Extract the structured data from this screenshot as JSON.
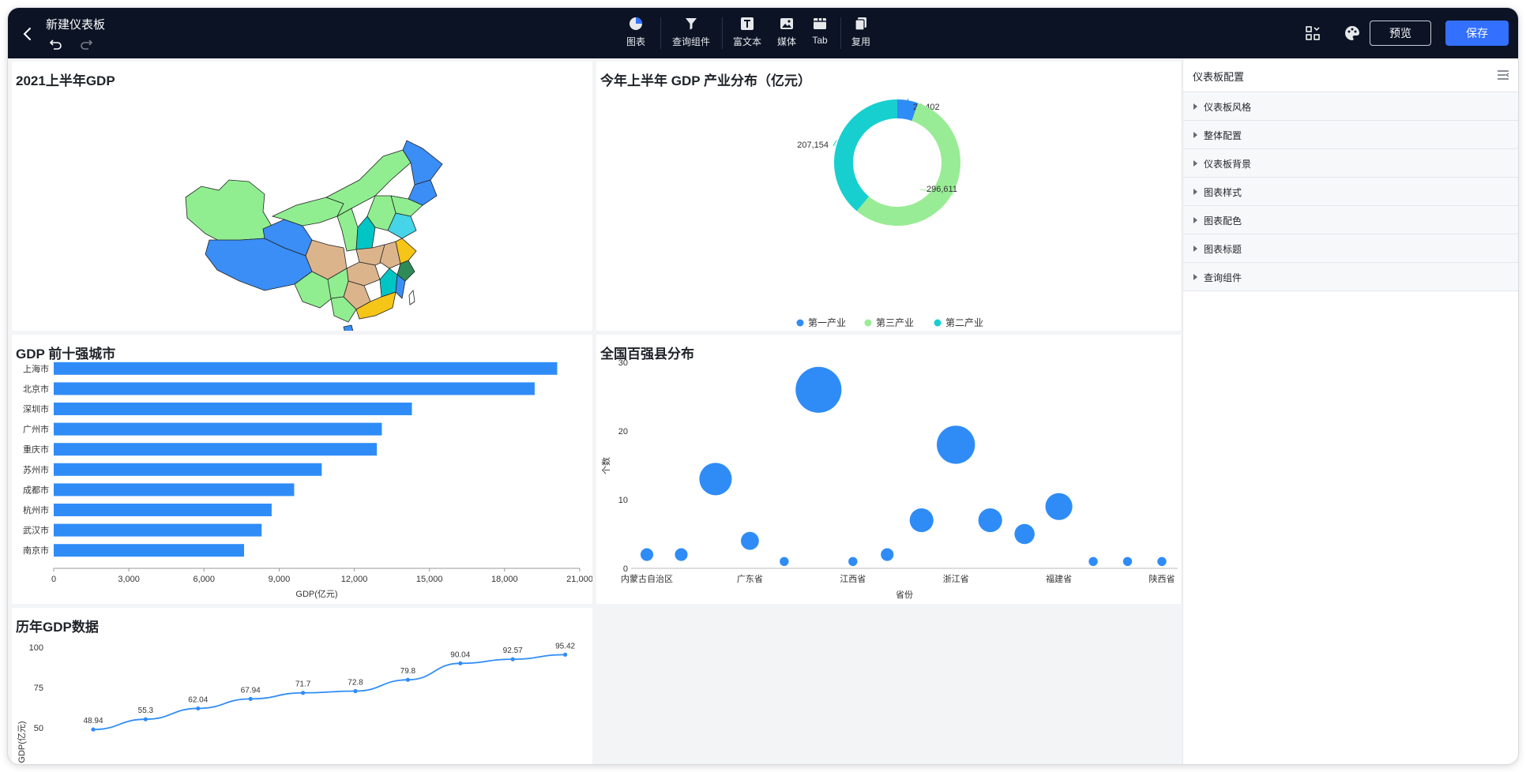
{
  "topbar": {
    "title": "新建仪表板",
    "tools": [
      {
        "label": "图表",
        "icon": "pie-chart-icon"
      },
      {
        "label": "查询组件",
        "icon": "filter-icon"
      },
      {
        "label": "富文本",
        "icon": "rich-text-icon"
      },
      {
        "label": "媒体",
        "icon": "image-icon"
      },
      {
        "label": "Tab",
        "icon": "tab-icon"
      },
      {
        "label": "复用",
        "icon": "copy-icon"
      }
    ],
    "preview_label": "预览",
    "save_label": "保存",
    "accent": "#3370ff",
    "background": "#0b1325"
  },
  "map_panel": {
    "title": "2021上半年GDP",
    "colors": [
      "#90ee90",
      "#3a8ef6",
      "#dcb48c",
      "#00c5c5",
      "#f5c518",
      "#3fbf4f",
      "#45d4e8",
      "#2e8b57"
    ]
  },
  "donut_panel": {
    "title": "今年上半年 GDP 产业分布（亿元）",
    "chart_data": {
      "type": "pie",
      "slices": [
        {
          "name": "第一产业",
          "value": 28402,
          "color": "#2f8cf7"
        },
        {
          "name": "第三产业",
          "value": 296611,
          "color": "#98ec95"
        },
        {
          "name": "第二产业",
          "value": 207154,
          "color": "#18cfd0"
        }
      ],
      "labels": [
        "28,402",
        "296,611",
        "207,154"
      ],
      "legend_placement": "bottom"
    }
  },
  "bar_panel": {
    "title": "GDP 前十强城市",
    "chart_data": {
      "type": "bar",
      "orientation": "horizontal",
      "categories": [
        "上海市",
        "北京市",
        "深圳市",
        "广州市",
        "重庆市",
        "苏州市",
        "成都市",
        "杭州市",
        "武汉市",
        "南京市"
      ],
      "values": [
        20100,
        19200,
        14300,
        13100,
        12900,
        10700,
        9600,
        8700,
        8300,
        7600
      ],
      "xlabel": "GDP(亿元)",
      "xlim": [
        0,
        21000
      ],
      "xticks": [
        "0",
        "3,000",
        "6,000",
        "9,000",
        "12,000",
        "15,000",
        "18,000",
        "21,000"
      ],
      "color": "#2f8cf7"
    }
  },
  "bubble_panel": {
    "title": "全国百强县分布",
    "chart_data": {
      "type": "scatter",
      "xlabel": "省份",
      "ylabel": "个数",
      "ylim": [
        0,
        30
      ],
      "yticks": [
        "0",
        "10",
        "20",
        "30"
      ],
      "xtick_labels": [
        "内蒙古自治区",
        "广东省",
        "江西省",
        "浙江省",
        "福建省",
        "陕西省"
      ],
      "values": [
        2,
        2,
        13,
        4,
        1,
        26,
        1,
        2,
        7,
        18,
        7,
        5,
        9,
        1,
        1,
        1
      ],
      "color": "#2f8cf7"
    }
  },
  "line_panel": {
    "title": "历年GDP数据",
    "chart_data": {
      "type": "line",
      "ylabel": "GDP(亿元)",
      "yticks": [
        "50",
        "75",
        "100"
      ],
      "values": [
        48.94,
        55.3,
        62.04,
        67.94,
        71.7,
        72.8,
        79.8,
        90.04,
        92.57,
        95.42
      ],
      "labels": [
        "48.94",
        "55.3",
        "62.04",
        "67.94",
        "71.7",
        "72.8",
        "79.8",
        "90.04",
        "92.57",
        "95.42"
      ],
      "color": "#2f8cf7"
    }
  },
  "side": {
    "title": "仪表板配置",
    "items": [
      "仪表板风格",
      "整体配置",
      "仪表板背景",
      "图表样式",
      "图表配色",
      "图表标题",
      "查询组件"
    ]
  }
}
